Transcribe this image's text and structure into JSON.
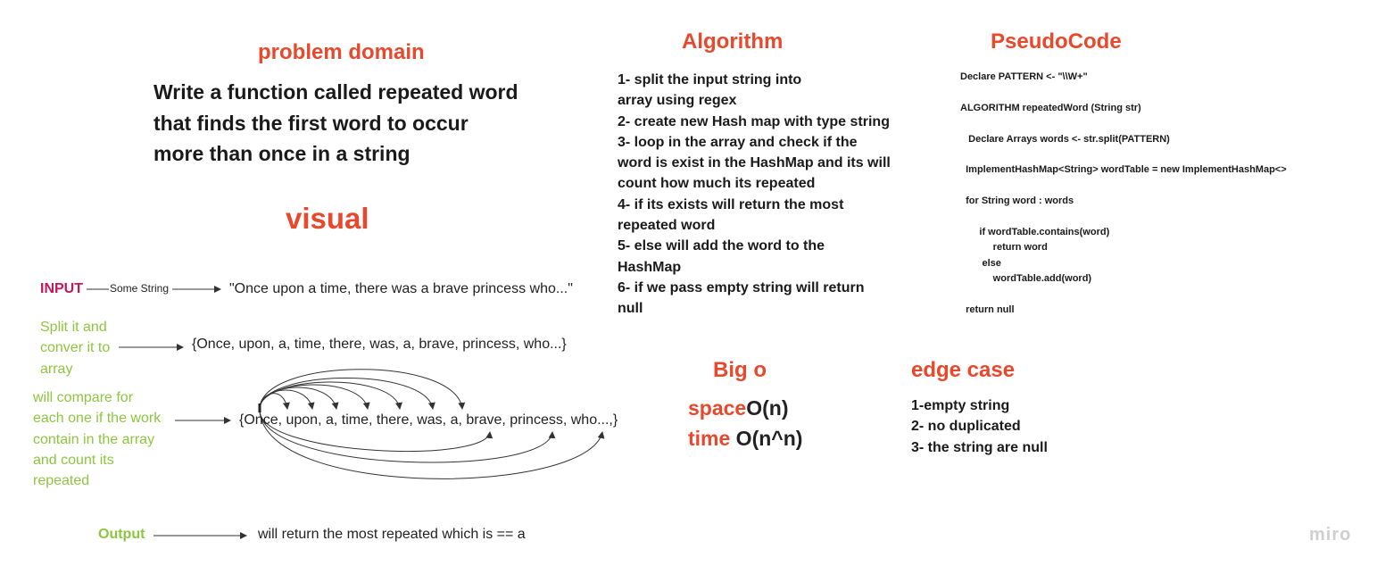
{
  "problem": {
    "title": "problem domain",
    "text": "Write a function called repeated word\nthat finds the first word to occur\nmore than once in a string"
  },
  "visual": {
    "title": "visual",
    "input_label": "INPUT",
    "some_string": "Some String",
    "input_value": "\"Once upon a time, there was a brave princess who...\"",
    "split_label": "Split it and\nconver it to\narray",
    "array_1": "{Once, upon, a, time, there, was, a, brave, princess, who...}",
    "compare_label": "will compare for\neach one  if the work\ncontain in the array\nand count its\nrepeated",
    "array_2": "{Once, upon, a, time, there, was, a, brave, princess, who...,}",
    "output_label": "Output",
    "output_value": "will return the most repeated which is == a"
  },
  "algorithm": {
    "title": "Algorithm",
    "text": "1- split the input string into\narray using regex\n2- create new Hash map with type string\n3- loop in the array and check if the\nword is exist in the HashMap and its will\ncount how much its repeated\n4- if its exists will  return the most\nrepeated word\n5- else will add  the word to the\nHashMap\n6- if we pass empty string will return\nnull"
  },
  "pseudocode": {
    "title": "PseudoCode",
    "code": "Declare PATTERN <- \"\\\\W+\"\n\nALGORITHM repeatedWord (String str)\n\n   Declare Arrays words <- str.split(PATTERN)\n\n  ImplementHashMap<String> wordTable = new ImplementHashMap<>\n\n  for String word : words\n\n       if wordTable.contains(word)\n            return word\n        else\n            wordTable.add(word)\n\n  return null"
  },
  "big_o": {
    "title": "Big o",
    "space_label": "space",
    "space_value": "O(n)",
    "time_label": "time",
    "time_value": " O(n^n)"
  },
  "edge_case": {
    "title": "edge case",
    "text": "1-empty string\n2- no duplicated\n3- the string are null"
  },
  "branding": {
    "logo": "miro"
  },
  "colors": {
    "heading": "#e8482c",
    "green_label": "#8cc63f",
    "input_label": "#c2185b"
  }
}
